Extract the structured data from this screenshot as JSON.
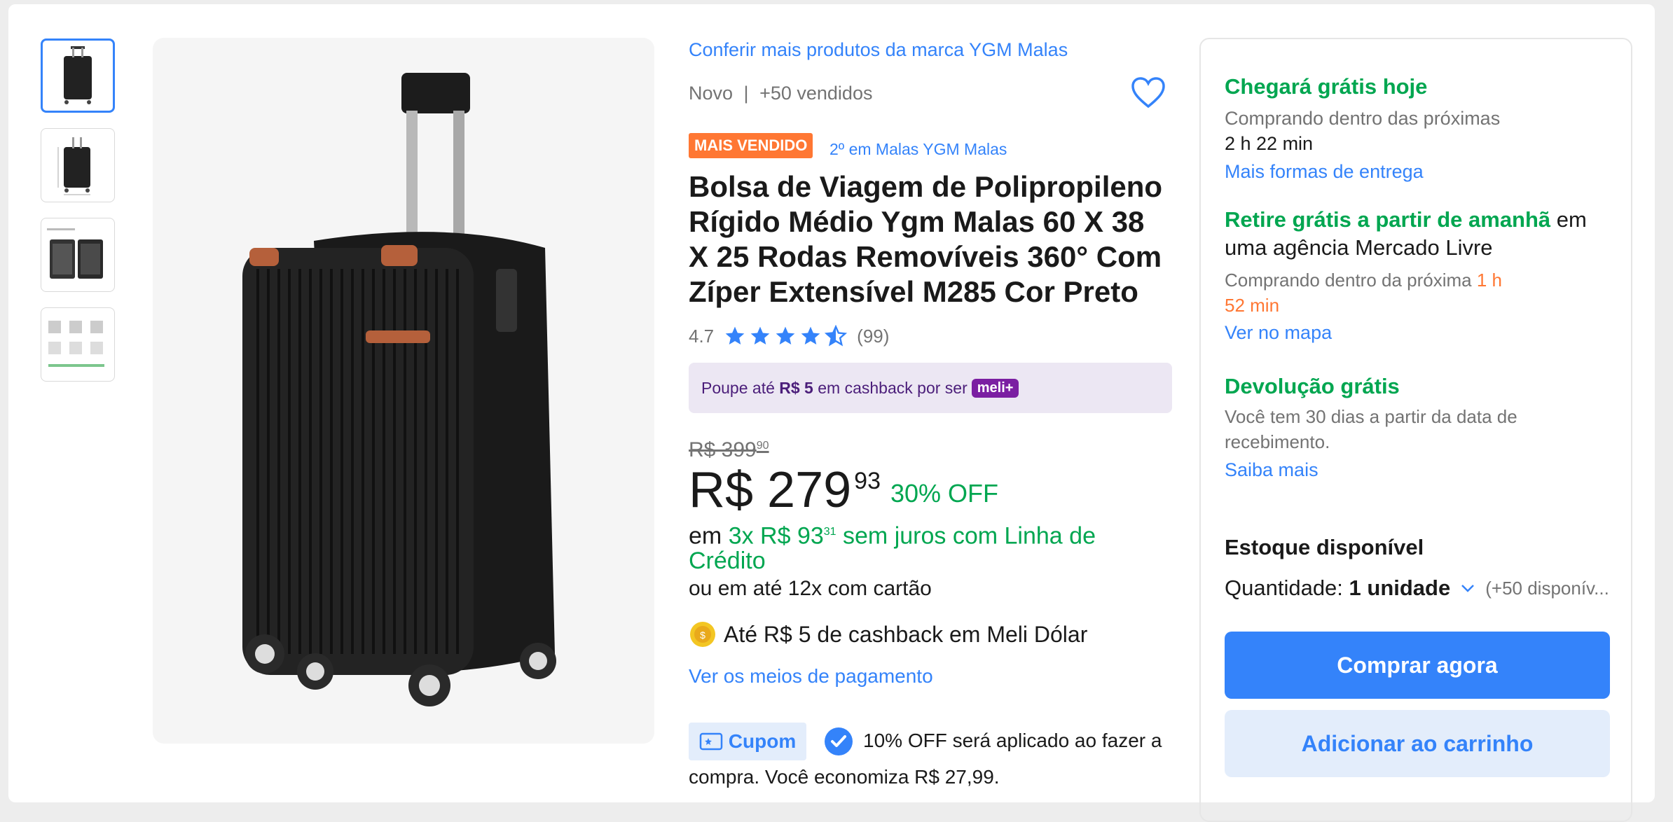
{
  "brand_link": "Conferir mais produtos da marca YGM Malas",
  "condition": "Novo",
  "separator": "|",
  "sold": "+50 vendidos",
  "badge": "MAIS VENDIDO",
  "ranking": "2º em Malas YGM Malas",
  "title_lines": [
    "Bolsa de Viagem de Polipropileno",
    "Rígido Médio Ygm Malas 60 X 38",
    "X 25 Rodas Removíveis 360° Com",
    "Zíper Extensível M285 Cor Preto"
  ],
  "rating": {
    "value": "4.7",
    "count": "(99)",
    "stars": 4.7
  },
  "cashback_banner": {
    "prefix": "Poupe até ",
    "amount": "R$ 5",
    "suffix": " em cashback por ser",
    "meli": "meli+"
  },
  "price": {
    "old_int": "R$ 399",
    "old_cents": "90",
    "int": "R$ 279",
    "cents": "93",
    "discount": "30% OFF",
    "inst_prefix": "em ",
    "inst_amount": "3x R$ 93",
    "inst_cents": "31",
    "inst_suffix_1": " sem juros com Linha de",
    "inst_suffix_2": "Crédito",
    "card": "ou em até 12x com cartão"
  },
  "meli_dolar": "Até R$ 5 de cashback em Meli Dólar",
  "payment_link": "Ver os meios de pagamento",
  "coupon": {
    "label": "Cupom",
    "line1": "10% OFF será aplicado ao fazer a",
    "line2": "compra. Você economiza R$ 27,99."
  },
  "shipping": {
    "title": "Chegará grátis hoje",
    "line1": "Comprando dentro das próximas",
    "time": "2 h 22 min",
    "link": "Mais formas de entrega"
  },
  "pickup": {
    "title": "Retire grátis a partir de amanhã",
    "suffix": " em",
    "line2": "uma agência Mercado Livre",
    "line3_prefix": "Comprando dentro da próxima ",
    "time_a": "1 h",
    "time_b": "52 min",
    "link": "Ver no mapa"
  },
  "returns": {
    "title": "Devolução grátis",
    "line1": "Você tem 30 dias a partir da data de",
    "line2": "recebimento.",
    "link": "Saiba mais"
  },
  "stock": {
    "title": "Estoque disponível",
    "qty_label": "Quantidade: ",
    "qty_value": "1 unidade",
    "available": "(+50 disponív..."
  },
  "buttons": {
    "buy": "Comprar agora",
    "cart": "Adicionar ao carrinho"
  },
  "icons": {
    "heart": "heart-icon",
    "star": "star-icon",
    "chevron": "chevron-down-icon",
    "check": "check-icon",
    "coupon": "coupon-icon",
    "coin": "coin-icon"
  },
  "colors": {
    "accent": "#3483fa",
    "green": "#00a650",
    "orange": "#ff7733",
    "meli_purple": "#6a0dad"
  }
}
